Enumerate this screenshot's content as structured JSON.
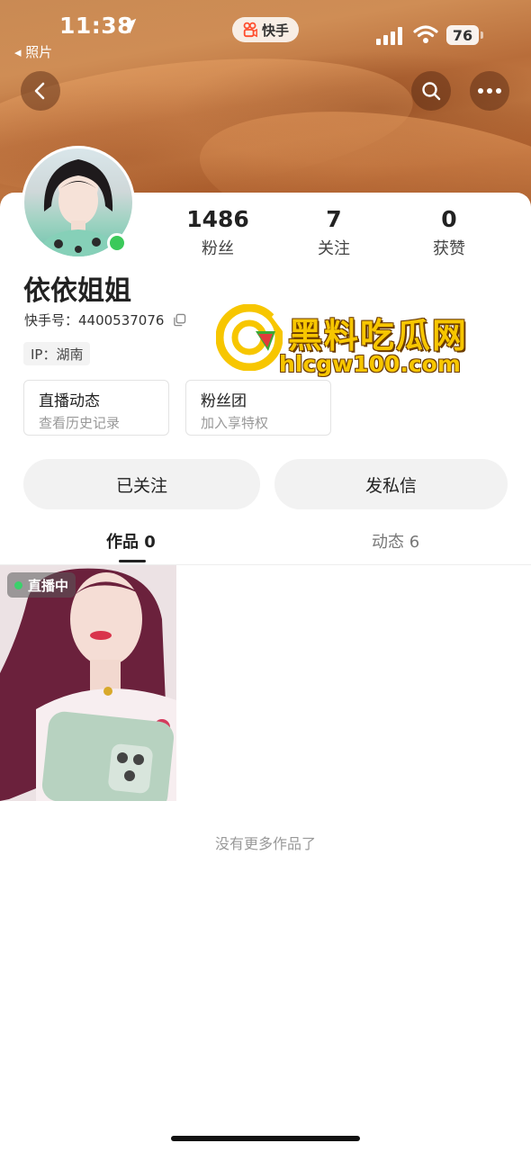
{
  "status_bar": {
    "time": "11:38",
    "back_app": "◂ 照片",
    "app_name": "快手",
    "battery": "76"
  },
  "profile": {
    "stats": [
      {
        "value": "1486",
        "label": "粉丝"
      },
      {
        "value": "7",
        "label": "关注"
      },
      {
        "value": "0",
        "label": "获赞"
      }
    ],
    "name": "依依姐姐",
    "kuaishou_id": "快手号：4400537076",
    "ip": "IP：湖南",
    "features": [
      {
        "title": "直播动态",
        "subtitle": "查看历史记录"
      },
      {
        "title": "粉丝团",
        "subtitle": "加入享特权"
      }
    ],
    "online_color": "#3bc95a"
  },
  "actions": {
    "followed": "已关注",
    "message": "发私信"
  },
  "tabs": [
    {
      "label": "作品 0",
      "active": true
    },
    {
      "label": "动态 6",
      "active": false
    }
  ],
  "works": {
    "live_badge": "直播中",
    "no_more": "没有更多作品了"
  },
  "watermark": {
    "title": "黑料吃瓜网",
    "url": "hlcgw100.com"
  }
}
